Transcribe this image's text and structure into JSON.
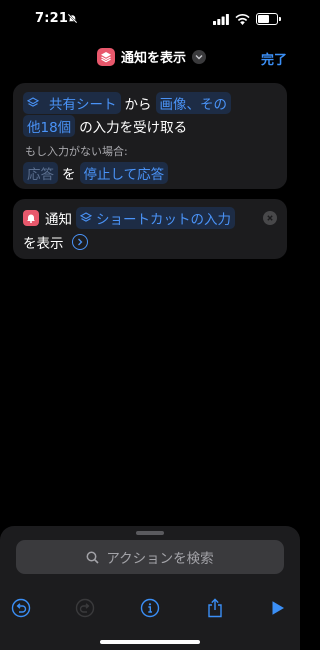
{
  "status": {
    "time": "7:21",
    "battery_level": 0.55
  },
  "nav": {
    "title": "通知を表示",
    "done_label": "完了"
  },
  "action1": {
    "token_share": "共有シート",
    "from": "から",
    "token_types_line1": "画像、その",
    "token_types_line2": "他18個",
    "receive_text": "の入力を受け取る",
    "no_input_label": "もし入力がない場合:",
    "token_respond": "応答",
    "wo": "を",
    "token_stop": "停止して応答"
  },
  "action2": {
    "label": "通知",
    "token_input": "ショートカットの入力",
    "show_text": "を表示"
  },
  "sheet": {
    "search_placeholder": "アクションを検索"
  },
  "colors": {
    "accent": "#3b8ff6",
    "notify_red": "#e8586c",
    "card": "#1c1c1e",
    "token_bg": "#1d2c45"
  }
}
